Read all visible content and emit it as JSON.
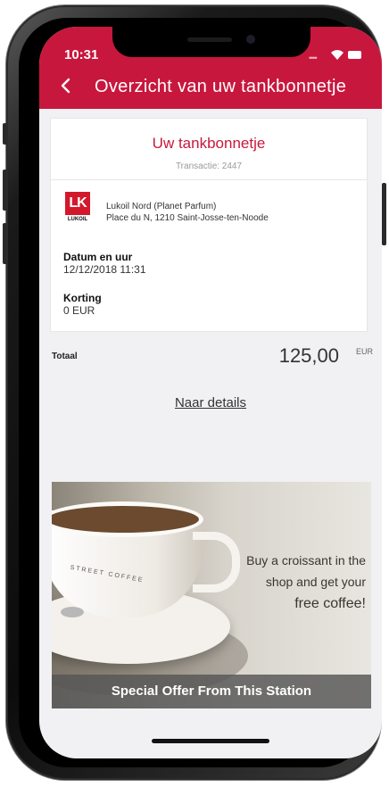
{
  "status_bar": {
    "time": "10:31"
  },
  "header": {
    "title": "Overzicht van uw tankbonnetje"
  },
  "receipt": {
    "title": "Uw tankbonnetje",
    "transaction": "Transactie: 2447",
    "logo_mark": "LK",
    "logo_text": "LUKOIL",
    "station_name": "Lukoil Nord (Planet Parfum)",
    "station_address": "Place du N, 1210 Saint-Josse-ten-Noode",
    "date_label": "Datum en uur",
    "date_value": "12/12/2018 11:31",
    "discount_label": "Korting",
    "discount_value": "0 EUR"
  },
  "total": {
    "label": "Totaal",
    "value": "125,00",
    "unit": "EUR"
  },
  "details_link": "Naar details",
  "promo": {
    "cup_text": "STREET COFFEE",
    "line1": "Buy a croissant in the",
    "line2": "shop and get your",
    "line3": "free coffee!",
    "footer": "Special Offer From This Station"
  },
  "colors": {
    "brand": "#c8173d",
    "background": "#f1f1f3"
  }
}
